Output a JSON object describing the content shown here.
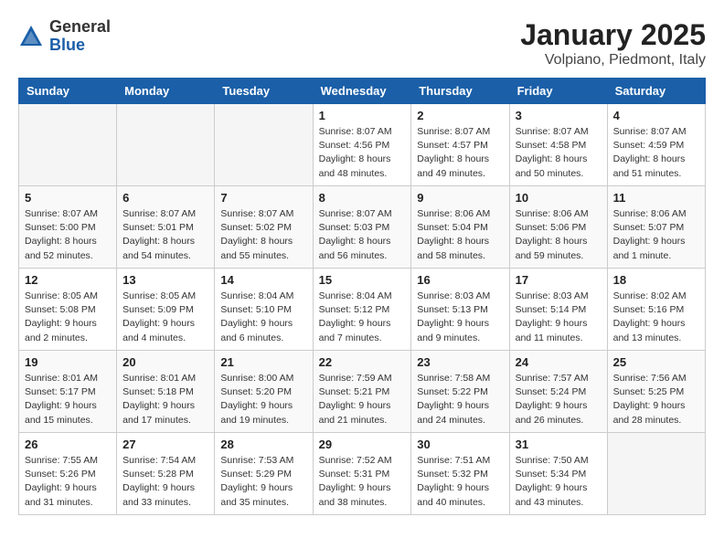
{
  "header": {
    "logo": {
      "general": "General",
      "blue": "Blue"
    },
    "month": "January 2025",
    "location": "Volpiano, Piedmont, Italy"
  },
  "weekdays": [
    "Sunday",
    "Monday",
    "Tuesday",
    "Wednesday",
    "Thursday",
    "Friday",
    "Saturday"
  ],
  "weeks": [
    {
      "days": [
        {
          "num": "",
          "info": "",
          "empty": true
        },
        {
          "num": "",
          "info": "",
          "empty": true
        },
        {
          "num": "",
          "info": "",
          "empty": true
        },
        {
          "num": "1",
          "info": "Sunrise: 8:07 AM\nSunset: 4:56 PM\nDaylight: 8 hours\nand 48 minutes."
        },
        {
          "num": "2",
          "info": "Sunrise: 8:07 AM\nSunset: 4:57 PM\nDaylight: 8 hours\nand 49 minutes."
        },
        {
          "num": "3",
          "info": "Sunrise: 8:07 AM\nSunset: 4:58 PM\nDaylight: 8 hours\nand 50 minutes."
        },
        {
          "num": "4",
          "info": "Sunrise: 8:07 AM\nSunset: 4:59 PM\nDaylight: 8 hours\nand 51 minutes."
        }
      ]
    },
    {
      "days": [
        {
          "num": "5",
          "info": "Sunrise: 8:07 AM\nSunset: 5:00 PM\nDaylight: 8 hours\nand 52 minutes."
        },
        {
          "num": "6",
          "info": "Sunrise: 8:07 AM\nSunset: 5:01 PM\nDaylight: 8 hours\nand 54 minutes."
        },
        {
          "num": "7",
          "info": "Sunrise: 8:07 AM\nSunset: 5:02 PM\nDaylight: 8 hours\nand 55 minutes."
        },
        {
          "num": "8",
          "info": "Sunrise: 8:07 AM\nSunset: 5:03 PM\nDaylight: 8 hours\nand 56 minutes."
        },
        {
          "num": "9",
          "info": "Sunrise: 8:06 AM\nSunset: 5:04 PM\nDaylight: 8 hours\nand 58 minutes."
        },
        {
          "num": "10",
          "info": "Sunrise: 8:06 AM\nSunset: 5:06 PM\nDaylight: 8 hours\nand 59 minutes."
        },
        {
          "num": "11",
          "info": "Sunrise: 8:06 AM\nSunset: 5:07 PM\nDaylight: 9 hours\nand 1 minute."
        }
      ]
    },
    {
      "days": [
        {
          "num": "12",
          "info": "Sunrise: 8:05 AM\nSunset: 5:08 PM\nDaylight: 9 hours\nand 2 minutes."
        },
        {
          "num": "13",
          "info": "Sunrise: 8:05 AM\nSunset: 5:09 PM\nDaylight: 9 hours\nand 4 minutes."
        },
        {
          "num": "14",
          "info": "Sunrise: 8:04 AM\nSunset: 5:10 PM\nDaylight: 9 hours\nand 6 minutes."
        },
        {
          "num": "15",
          "info": "Sunrise: 8:04 AM\nSunset: 5:12 PM\nDaylight: 9 hours\nand 7 minutes."
        },
        {
          "num": "16",
          "info": "Sunrise: 8:03 AM\nSunset: 5:13 PM\nDaylight: 9 hours\nand 9 minutes."
        },
        {
          "num": "17",
          "info": "Sunrise: 8:03 AM\nSunset: 5:14 PM\nDaylight: 9 hours\nand 11 minutes."
        },
        {
          "num": "18",
          "info": "Sunrise: 8:02 AM\nSunset: 5:16 PM\nDaylight: 9 hours\nand 13 minutes."
        }
      ]
    },
    {
      "days": [
        {
          "num": "19",
          "info": "Sunrise: 8:01 AM\nSunset: 5:17 PM\nDaylight: 9 hours\nand 15 minutes."
        },
        {
          "num": "20",
          "info": "Sunrise: 8:01 AM\nSunset: 5:18 PM\nDaylight: 9 hours\nand 17 minutes."
        },
        {
          "num": "21",
          "info": "Sunrise: 8:00 AM\nSunset: 5:20 PM\nDaylight: 9 hours\nand 19 minutes."
        },
        {
          "num": "22",
          "info": "Sunrise: 7:59 AM\nSunset: 5:21 PM\nDaylight: 9 hours\nand 21 minutes."
        },
        {
          "num": "23",
          "info": "Sunrise: 7:58 AM\nSunset: 5:22 PM\nDaylight: 9 hours\nand 24 minutes."
        },
        {
          "num": "24",
          "info": "Sunrise: 7:57 AM\nSunset: 5:24 PM\nDaylight: 9 hours\nand 26 minutes."
        },
        {
          "num": "25",
          "info": "Sunrise: 7:56 AM\nSunset: 5:25 PM\nDaylight: 9 hours\nand 28 minutes."
        }
      ]
    },
    {
      "days": [
        {
          "num": "26",
          "info": "Sunrise: 7:55 AM\nSunset: 5:26 PM\nDaylight: 9 hours\nand 31 minutes."
        },
        {
          "num": "27",
          "info": "Sunrise: 7:54 AM\nSunset: 5:28 PM\nDaylight: 9 hours\nand 33 minutes."
        },
        {
          "num": "28",
          "info": "Sunrise: 7:53 AM\nSunset: 5:29 PM\nDaylight: 9 hours\nand 35 minutes."
        },
        {
          "num": "29",
          "info": "Sunrise: 7:52 AM\nSunset: 5:31 PM\nDaylight: 9 hours\nand 38 minutes."
        },
        {
          "num": "30",
          "info": "Sunrise: 7:51 AM\nSunset: 5:32 PM\nDaylight: 9 hours\nand 40 minutes."
        },
        {
          "num": "31",
          "info": "Sunrise: 7:50 AM\nSunset: 5:34 PM\nDaylight: 9 hours\nand 43 minutes."
        },
        {
          "num": "",
          "info": "",
          "empty": true
        }
      ]
    }
  ]
}
